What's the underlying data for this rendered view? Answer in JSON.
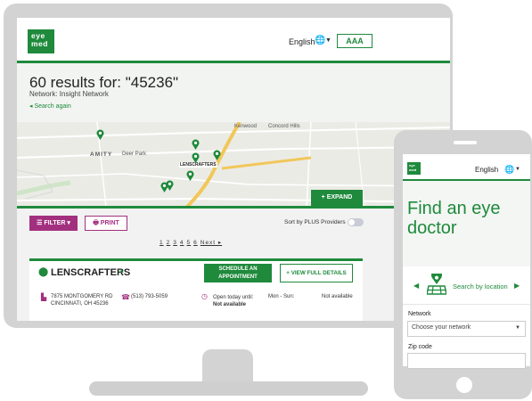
{
  "desktop": {
    "header": {
      "logo_text": "eye med",
      "language": "English",
      "globe_icon": "globe-icon",
      "caret": "▼",
      "text_size_label": "AAA"
    },
    "results": {
      "title": "60 results for: \"45236\"",
      "network": "Network: Insight Network",
      "search_again": "◂ Search again"
    },
    "map": {
      "labels": {
        "kenwood": "Kenwood",
        "concord_hills": "Concord Hills",
        "amity": "AMITY",
        "deer_park": "Deer Park",
        "lenscrafters": "LENSCRAFTERS"
      },
      "expand_label": "+ EXPAND"
    },
    "toolbar": {
      "filter_label": "☰ FILTER ▾",
      "print_label": "PRINT",
      "sort_label": "Sort by PLUS Providers"
    },
    "pagination": {
      "pages": [
        "1",
        "2",
        "3",
        "4",
        "5",
        "6"
      ],
      "next": "Next ▸"
    },
    "card": {
      "name": "LENSCRAFTERS",
      "caret": "▲",
      "schedule_line1": "SCHEDULE AN",
      "schedule_line2": "APPOINTMENT",
      "details_label": "+ VIEW FULL DETAILS",
      "address_line1": "7875 MONTGOMERY RD",
      "address_line2": "CINCINNATI, OH 45236",
      "phone": "(513) 793-5059",
      "hours_line1": "Open today until:",
      "hours_line2": "Not available",
      "days": "Mon - Sun:",
      "availability": "Not available"
    }
  },
  "mobile": {
    "logo_text": "eye med",
    "language": "English",
    "hero_title": "Find an eye doctor",
    "location_label": "Search by location",
    "network_label": "Network",
    "network_placeholder": "Choose your network",
    "zip_label": "Zip code"
  },
  "colors": {
    "brand_green": "#1f8a3c",
    "accent_purple": "#a2307f",
    "device_gray": "#d3d3d3"
  }
}
